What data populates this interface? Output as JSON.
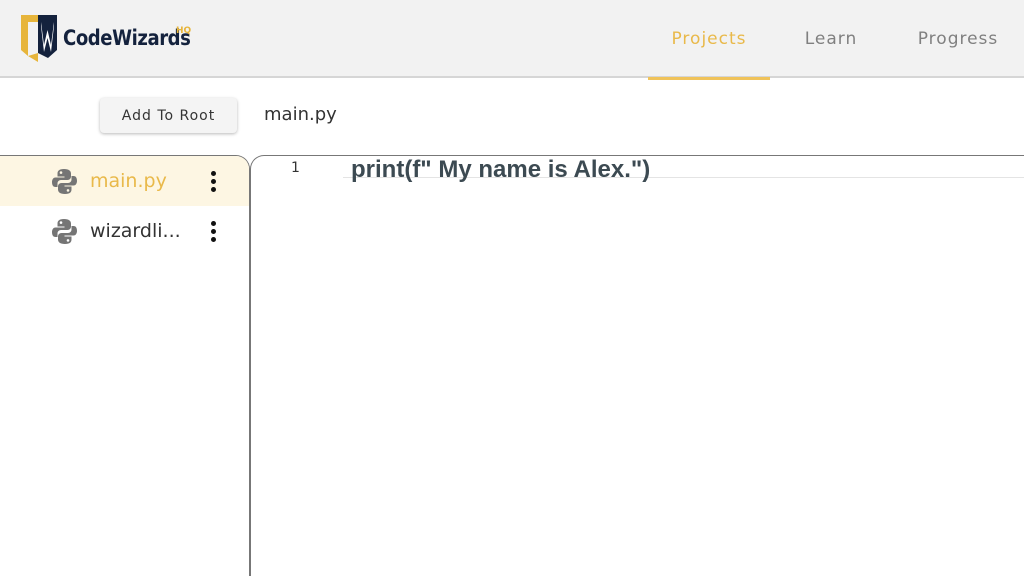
{
  "brand": {
    "name": "CodeWizards",
    "suffix": "HQ",
    "colors": {
      "navy": "#14223d",
      "gold": "#e7b53b"
    }
  },
  "nav": {
    "tabs": [
      {
        "label": "Projects",
        "active": true
      },
      {
        "label": "Learn",
        "active": false
      },
      {
        "label": "Progress",
        "active": false
      }
    ]
  },
  "toolbar": {
    "add_to_root_label": "Add To Root",
    "current_file": "main.py"
  },
  "sidebar": {
    "files": [
      {
        "label": "main.py",
        "icon": "python-icon",
        "active": true
      },
      {
        "label": "wizardli...",
        "icon": "python-icon",
        "active": false
      }
    ]
  },
  "editor": {
    "lines": [
      {
        "number": "1",
        "code": "print(f\" My name is Alex.\")"
      }
    ]
  },
  "colors": {
    "accent": "#e9b94a",
    "active_row_bg": "#fdf6e3"
  }
}
